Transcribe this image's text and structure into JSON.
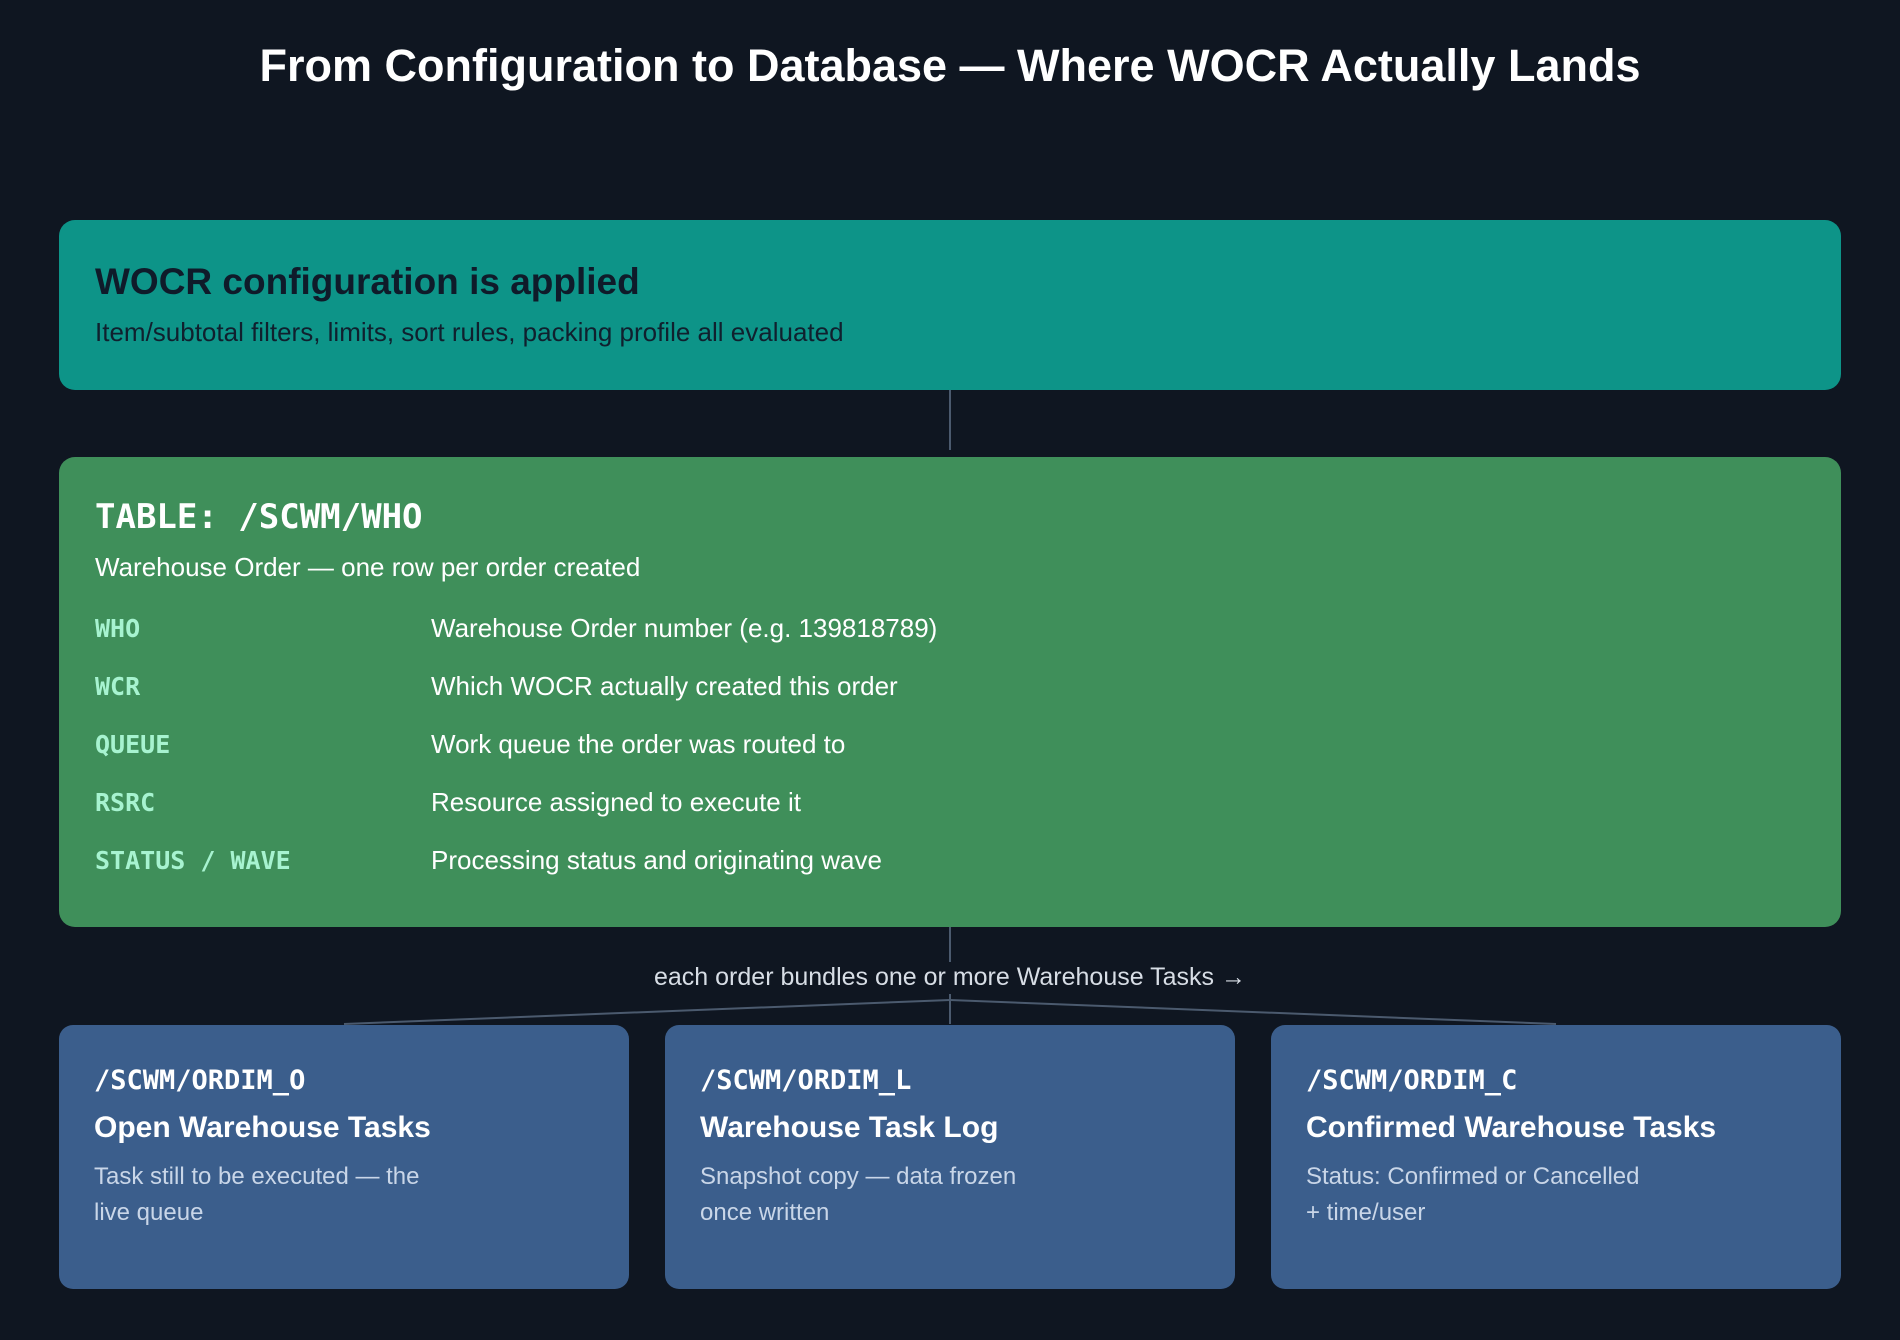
{
  "title": "From Configuration to Database — Where WOCR Actually Lands",
  "config": {
    "title": "WOCR configuration is applied",
    "subtitle": "Item/subtotal filters, limits, sort rules, packing profile all evaluated"
  },
  "table": {
    "title": "TABLE: /SCWM/WHO",
    "subtitle": "Warehouse Order — one row per order created",
    "fields": [
      {
        "name": "WHO",
        "desc": "Warehouse Order number (e.g. 139818789)"
      },
      {
        "name": "WCR",
        "desc": "Which WOCR actually created this order"
      },
      {
        "name": "QUEUE",
        "desc": "Work queue the order was routed to"
      },
      {
        "name": "RSRC",
        "desc": "Resource assigned to execute it"
      },
      {
        "name": "STATUS / WAVE",
        "desc": "Processing status and originating wave"
      }
    ]
  },
  "bundle_label": "each order bundles one or more Warehouse Tasks →",
  "tasks": [
    {
      "code": "/SCWM/ORDIM_O",
      "name": "Open Warehouse Tasks",
      "desc": "Task still to be executed — the live queue"
    },
    {
      "code": "/SCWM/ORDIM_L",
      "name": "Warehouse Task Log",
      "desc": "Snapshot copy — data frozen once written"
    },
    {
      "code": "/SCWM/ORDIM_C",
      "name": "Confirmed Warehouse Tasks",
      "desc": "Status: Confirmed or Cancelled + time/user"
    }
  ],
  "colors": {
    "background": "#0f1621",
    "config_box": "#0d9488",
    "table_box": "#3f8f5a",
    "task_box": "#3b5e8c",
    "field_name": "#a7f3d0",
    "connector": "#4b5a6e"
  }
}
